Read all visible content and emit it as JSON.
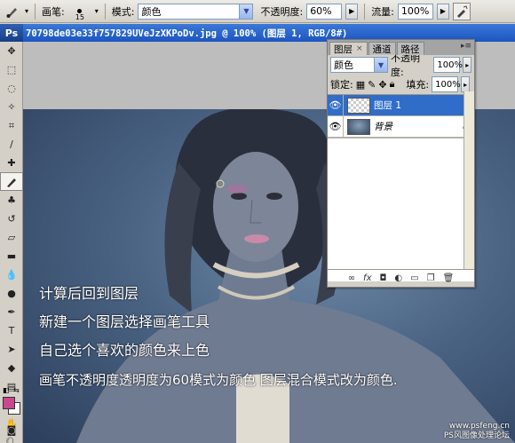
{
  "options_bar": {
    "brush_label": "画笔:",
    "brush_size": "15",
    "mode_label": "模式:",
    "mode_value": "颜色",
    "opacity_label": "不透明度:",
    "opacity_value": "60%",
    "flow_label": "流量:",
    "flow_value": "100%"
  },
  "toolbox": {
    "logo": "Ps",
    "foreground_color": "#c9478e",
    "background_color": "#ffffff"
  },
  "document": {
    "title": "70798de03e33f757829UVeJzXKPoDv.jpg @ 100% (图层 1, RGB/8#)",
    "captions": [
      "计算后回到图层",
      "新建一个图层选择画笔工具",
      "自己选个喜欢的颜色来上色",
      "画笔不透明度透明度为60模式为颜色  图层混合模式改为颜色."
    ],
    "watermark_url": "www.psfeng.cn",
    "watermark_text": "PS风图像处理论坛"
  },
  "layers_panel": {
    "tabs": [
      "图层",
      "通道",
      "路径"
    ],
    "blend_mode": "颜色",
    "opacity_label": "不透明度:",
    "opacity_value": "100%",
    "lock_label": "锁定:",
    "fill_label": "填充:",
    "fill_value": "100%",
    "layers": [
      {
        "name": "图层 1",
        "selected": true
      },
      {
        "name": "背景",
        "selected": false,
        "locked": true
      }
    ],
    "footer_icons": [
      "link-icon",
      "fx-icon",
      "mask-icon",
      "adjustment-icon",
      "group-icon",
      "new-layer-icon",
      "trash-icon"
    ]
  }
}
